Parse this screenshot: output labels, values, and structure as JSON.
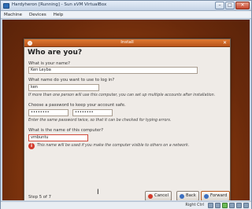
{
  "window": {
    "title": "Hardyheron [Running] - Sun xVM VirtualBox",
    "minimize_glyph": "–",
    "maximize_glyph": "□",
    "close_glyph": "✕"
  },
  "menubar": {
    "items": [
      "Machine",
      "Devices",
      "Help"
    ]
  },
  "installer": {
    "title": "Install",
    "close_glyph": "✕",
    "heading": "Who are you?",
    "name": {
      "label": "What is your name?",
      "value": "Ken Leyba"
    },
    "login": {
      "label": "What name do you want to use to log in?",
      "value": "ken",
      "hint": "If more than one person will use this computer, you can set up multiple accounts after installation."
    },
    "password": {
      "label": "Choose a password to keep your account safe.",
      "value": "••••••••",
      "confirm_value": "••••••••",
      "hint": "Enter the same password twice, so that it can be checked for typing errors."
    },
    "computer_name": {
      "label": "What is the name of this computer?",
      "value": "vmbuntu",
      "hint": "This name will be used if you make the computer visible to others on a network."
    },
    "step_text": "Step 5 of 7",
    "buttons": {
      "cancel": "Cancel",
      "back": "Back",
      "forward": "Forward"
    }
  },
  "colors": {
    "accent": "#c9601d",
    "error": "#d33a2c"
  },
  "status": {
    "host_key": "Right Ctrl"
  }
}
